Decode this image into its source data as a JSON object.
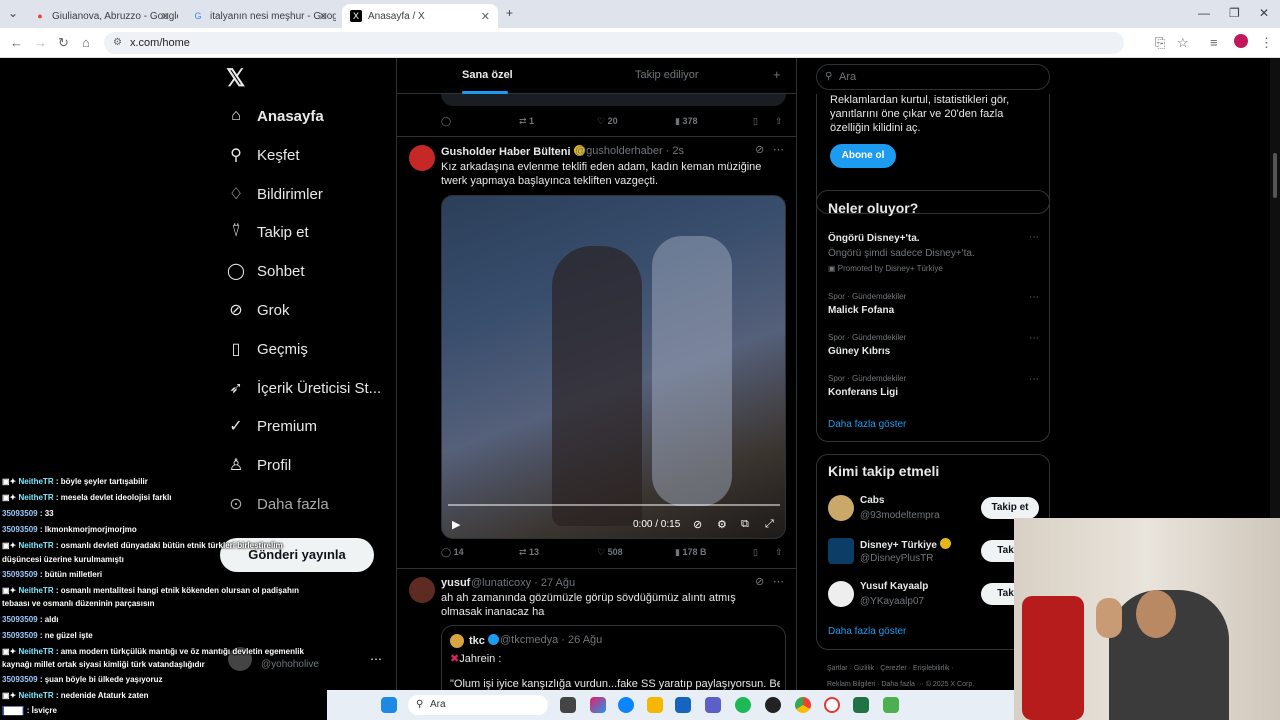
{
  "browser": {
    "tabs": [
      {
        "title": "Giulianova, Abruzzo - Google H",
        "icon": "maps-icon"
      },
      {
        "title": "italyanın nesi meşhur - Google",
        "icon": "google-icon"
      },
      {
        "title": "Anasayfa / X",
        "icon": "x-icon"
      }
    ],
    "url": "x.com/home"
  },
  "sidebar": {
    "items": [
      {
        "label": "Anasayfa",
        "icon": "home-icon",
        "glyph": "⌂"
      },
      {
        "label": "Keşfet",
        "icon": "search-icon",
        "glyph": "⚲"
      },
      {
        "label": "Bildirimler",
        "icon": "bell-icon",
        "glyph": "🔔"
      },
      {
        "label": "Takip et",
        "icon": "add-user-icon",
        "glyph": "👤"
      },
      {
        "label": "Sohbet",
        "icon": "chat-icon",
        "glyph": "💬"
      },
      {
        "label": "Grok",
        "icon": "grok-icon",
        "glyph": "⊘"
      },
      {
        "label": "Geçmiş",
        "icon": "bookmark-icon",
        "glyph": "🔖"
      },
      {
        "label": "İçerik Üreticisi St...",
        "icon": "rocket-icon",
        "glyph": "➶"
      },
      {
        "label": "Premium",
        "icon": "premium-icon",
        "glyph": "✓"
      },
      {
        "label": "Profil",
        "icon": "profile-icon",
        "glyph": "👤"
      },
      {
        "label": "Daha fazla",
        "icon": "more-icon",
        "glyph": "⋯"
      }
    ],
    "post_button": "Gönderi yayınla",
    "account_handle": "@yohoholive"
  },
  "feed": {
    "tabs": [
      "Sana özel",
      "Takip ediliyor"
    ],
    "prev_tweet_actions": {
      "reply": "",
      "retweet": "1",
      "like": "20",
      "views": "378"
    },
    "tweet1": {
      "name": "Gusholder Haber Bülteni",
      "handle": "@gusholderhaber · 2s",
      "text": "Kız arkadaşına evlenme teklifi eden adam, kadın keman müziğine twerk yapmaya başlayınca tekliften vazgeçti.",
      "video_time": "0:00 / 0:15",
      "actions": {
        "reply": "14",
        "retweet": "13",
        "like": "508",
        "views": "178 B"
      }
    },
    "tweet2": {
      "name": "yusuf",
      "handle": "@lunaticoxy · 27 Ağu",
      "text": "ah ah zamanında gözümüzle görüp sövdüğümüz alıntı atmış olmasak inanacaz ha",
      "quote_name": "tkc",
      "quote_handle": "@tkcmedya · 26 Ağu",
      "quote_text": "Jahrein :",
      "quote_more": "\"Olum işi iyice kanşızlığa vurdun...fake SS yaratıp paylaşıyorsun. Benim"
    }
  },
  "right": {
    "search_placeholder": "Ara",
    "premium_text": "Reklamlardan kurtul, istatistikleri gör, yanıtlarını öne çıkar ve 20'den fazla özelliğin kilidini aç.",
    "premium_button": "Abone ol",
    "trends_title": "Neler oluyor?",
    "trends": [
      {
        "meta": "Öngörü Disney+'ta.",
        "name": "",
        "sub": "Öngörü şimdi sadece Disney+'ta.",
        "promo": "Promoted by Disney+ Türkiye"
      },
      {
        "meta": "Spor · Gündemdekiler",
        "name": "Malick Fofana"
      },
      {
        "meta": "Spor · Gündemdekiler",
        "name": "Güney Kıbrıs"
      },
      {
        "meta": "Spor · Gündemdekiler",
        "name": "Konferans Ligi"
      }
    ],
    "show_more": "Daha fazla göster",
    "who_title": "Kimi takip etmeli",
    "who": [
      {
        "name": "Cabs",
        "handle": "@93modeltempra",
        "button": "Takip et"
      },
      {
        "name": "Disney+ Türkiye",
        "handle": "@DisneyPlusTR",
        "button": "Takip"
      },
      {
        "name": "Yusuf Kayaalp",
        "handle": "@YKayaalp07",
        "button": "Takip"
      }
    ],
    "who_more": "Daha fazla göster",
    "footer": "Şartlar · Gizlilik · Çerezler · Erişilebilirlik ·",
    "footer2": "Reklam Bilgileri · Daha fazla ··· © 2025 X Corp."
  },
  "chat": [
    {
      "user": "NeitheTR",
      "msg": ": böyle şeyler tartışabilir"
    },
    {
      "user": "NeitheTR",
      "msg": ": mesela devlet ideolojisi farklı"
    },
    {
      "user": "35093509",
      "msg": ": 33"
    },
    {
      "user": "35093509",
      "msg": ": lkmonkmorjmorjmorjmo"
    },
    {
      "user": "NeitheTR",
      "msg": ": osmanlı devleti dünyadaki bütün etnik türkleri birleştirelim"
    },
    {
      "user": "",
      "msg": "düşüncesi üzerine kurulmamıştı"
    },
    {
      "user": "35093509",
      "msg": ": bütün milletleri"
    },
    {
      "user": "NeitheTR",
      "msg": ": osmanlı mentalitesi hangi etnik kökenden olursan ol padişahın"
    },
    {
      "user": "",
      "msg": "tebaası ve osmanlı düzeninin parçasısın"
    },
    {
      "user": "35093509",
      "msg": ": aldı"
    },
    {
      "user": "35093509",
      "msg": ": ne güzel işte"
    },
    {
      "user": "NeitheTR",
      "msg": ": ama modern türkçülük mantığı ve öz mantığı devletin egemenlik"
    },
    {
      "user": "",
      "msg": "kaynağı millet ortak siyasi kimliği türk vatandaşlığıdır"
    },
    {
      "user": "35093509",
      "msg": ": şuan böyle bi ülkede yaşıyoruz"
    },
    {
      "user": "NeitheTR",
      "msg": ": nedenide Ataturk zaten"
    },
    {
      "user": "",
      "msg": ": İsviçre"
    }
  ],
  "taskbar": {
    "search": "Ara"
  }
}
